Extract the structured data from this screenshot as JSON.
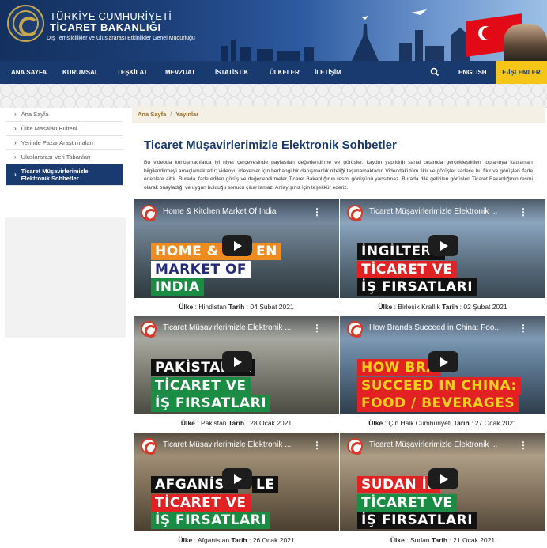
{
  "header": {
    "brand_line1": "TÜRKİYE CUMHURİYETİ",
    "brand_line2": "TİCARET BAKANLIĞI",
    "brand_line3": "Dış Temsilcilikler ve Uluslararası Etkinlikler Genel Müdürlüğü"
  },
  "nav": {
    "items": [
      "ANA SAYFA",
      "KURUMSAL",
      "TEŞKİLAT",
      "MEVZUAT",
      "İSTATİSTİK",
      "ÜLKELER",
      "İLETİŞİM"
    ],
    "english": "ENGLISH",
    "eislemler": "E-İŞLEMLER"
  },
  "sidebar": {
    "items": [
      "Ana Sayfa",
      "Ülke Masaları Bülteni",
      "Yerinde Pazar Araştırmaları",
      "Uluslararası Veri Tabanları",
      "Ticaret Müşavirlerimizle Elektronik Sohbetler"
    ]
  },
  "breadcrumb": {
    "home": "Ana Sayfa",
    "current": "Yayınlar"
  },
  "page": {
    "title": "Ticaret Müşavirlerimizle Elektronik Sohbetler",
    "intro": "Bu videoda konuşmacılarca iyi niyet çerçevesinde paylaşılan değerlendirme ve görüşler, kaydın yapıldığı sanal ortamda gerçekleştirilen toplantıya katılanları bilgilendirmeyi amaçlamaktadır; videoyu izleyenler için herhangi bir danışmanlık niteliği taşımamaktadır. Videodaki tüm fikir ve görüşler sadece bu fikir ve görüşleri ifade edenlere aittir. Burada ifade edilen görüş ve değerlendirmeler Ticaret Bakanlığının resmi görüşünü yansıtmaz. Burada dile getirilen görüşleri Ticaret Bakanlığının resmi olarak onayladığı ve uygun bulduğu sonucu çıkarılamaz. Anlayışınız için teşekkür ederiz."
  },
  "labels": {
    "country": "Ülke",
    "date": "Tarih"
  },
  "videos": [
    {
      "title": "Home & Kitchen Market Of India",
      "cap1": "HOME & KIT",
      "cap1b": "EN",
      "cap2": "MARKET OF",
      "cap3": "INDIA",
      "country": "Hindistan",
      "date": "04 Şubat 2021"
    },
    {
      "title": "Ticaret Müşavirlerimizle Elektronik ...",
      "cap1": "İNGİLTERE",
      "cap2": "TİCARET VE",
      "cap3": "İŞ FIRSATLARI",
      "country": "Birleşik Krallık",
      "date": "02 Şubat 2021"
    },
    {
      "title": "Ticaret Müşavirlerimizle Elektronik ...",
      "cap1": "PAKİSTAN İL",
      "cap2": "TİCARET VE",
      "cap3": "İŞ FIRSATLARI",
      "country": "Pakistan",
      "date": "28 Ocak 2021"
    },
    {
      "title": "How Brands Succeed in China: Foo...",
      "cap1": "HOW BRA",
      "cap2": "SUCCEED IN CHINA:",
      "cap3": "FOOD / BEVERAGES",
      "country": "Çin Halk Cumhuriyeti",
      "date": "27 Ocak 2021"
    },
    {
      "title": "Ticaret Müşavirlerimizle Elektronik ...",
      "cap1": "AFGANİST",
      "cap1b": "LE",
      "cap2": "TİCARET VE",
      "cap3": "İŞ FIRSATLARI",
      "country": "Afganistan",
      "date": "26 Ocak 2021"
    },
    {
      "title": "Ticaret Müşavirlerimizle Elektronik ...",
      "cap1": "SUDAN İL",
      "cap2": "TİCARET VE",
      "cap3": "İŞ FIRSATLARI",
      "country": "Sudan",
      "date": "21 Ocak 2021"
    }
  ],
  "colors": {
    "navy": "#193a6f",
    "accent_yellow": "#f5c518",
    "caption_red": "#e22222",
    "caption_green": "#1a8c43"
  }
}
